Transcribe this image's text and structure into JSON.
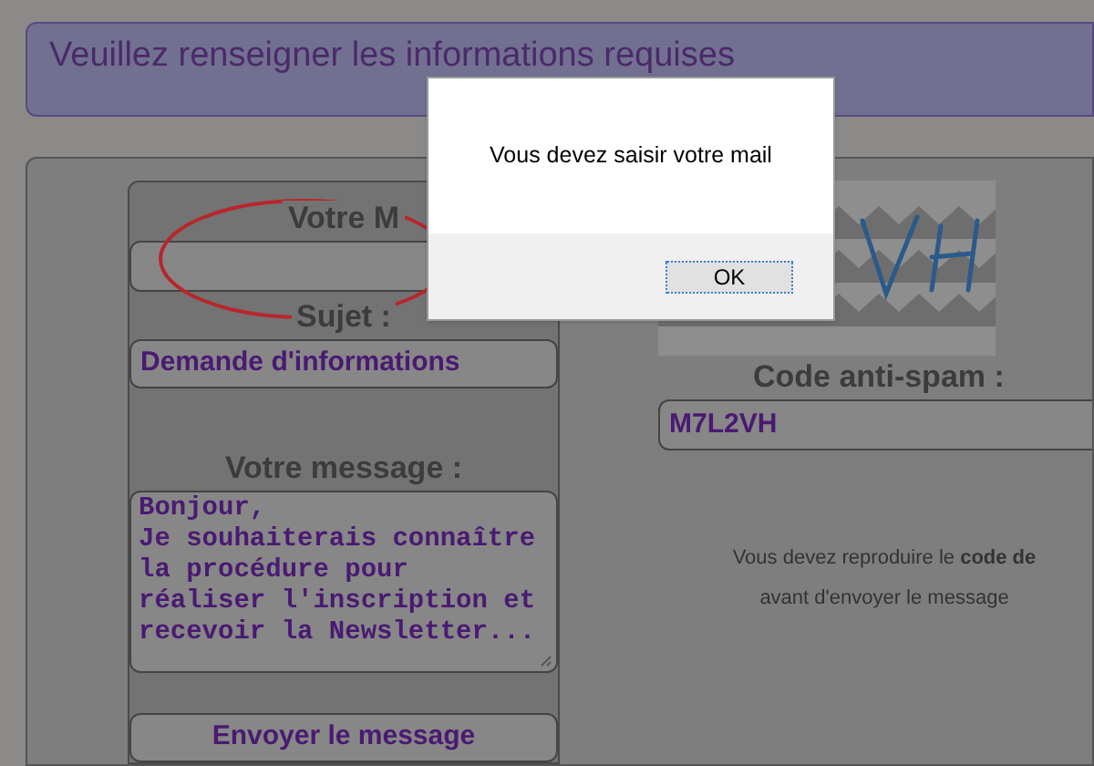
{
  "header": {
    "text": "Veuillez renseigner les informations requises"
  },
  "form": {
    "fields": [
      {
        "kind": "input",
        "label": "Votre M"
      },
      {
        "kind": "input",
        "label": "Sujet :",
        "value": "Demande d'informations"
      },
      {
        "kind": "textarea",
        "label": "Votre message :",
        "value": "Bonjour,\nJe souhaiterais connaître\nla procédure pour\nréaliser l'inscription et\nrecevoir la Newsletter..."
      }
    ],
    "submit_button": "Envoyer le message"
  },
  "captcha": {
    "image": {
      "kind": "picture"
    },
    "label": "Code anti-spam :",
    "value": "M7L2VH",
    "hint_lines": [
      "Vous devez reproduire le **code de**",
      "avant d'envoyer le message"
    ]
  },
  "dialog": {
    "message": "Vous devez saisir votre mail",
    "buttons": [
      "OK"
    ]
  }
}
